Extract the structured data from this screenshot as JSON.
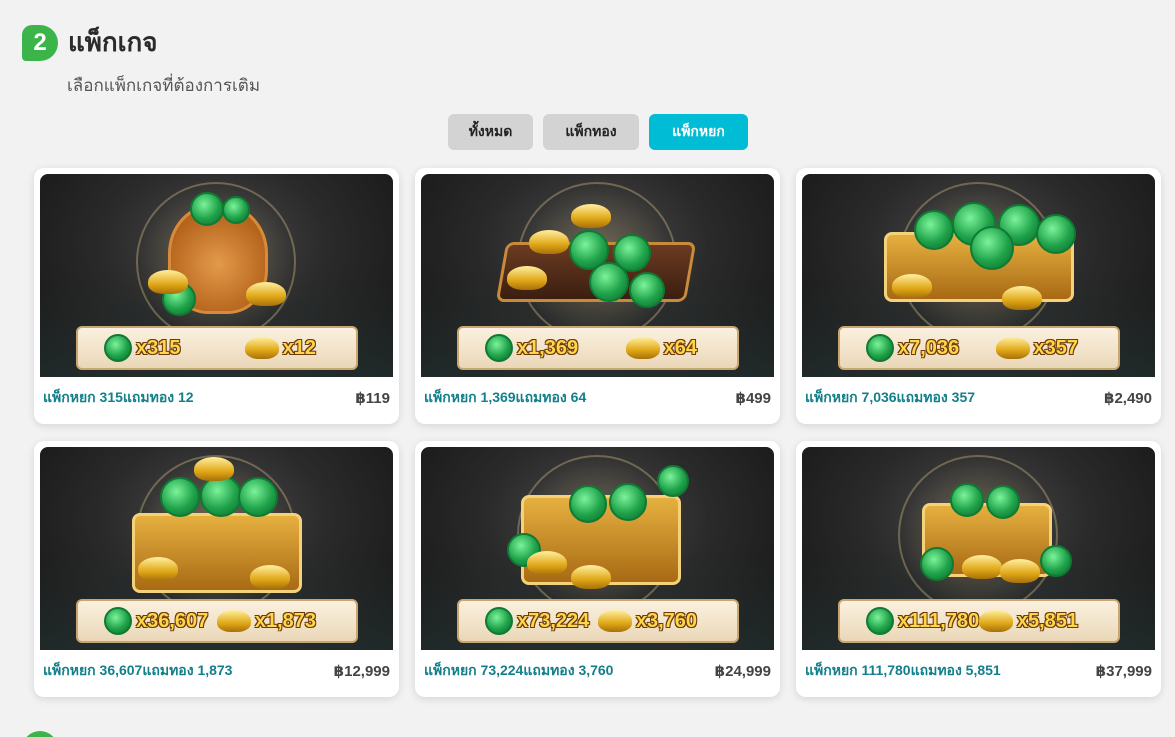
{
  "step": {
    "number": "2",
    "title": "แพ็กเกจ",
    "subtitle": "เลือกแพ็กเกจที่ต้องการเติม"
  },
  "tabs": [
    {
      "label": "ทั้งหมด",
      "active": false
    },
    {
      "label": "แพ็กทอง",
      "active": false
    },
    {
      "label": "แพ็กหยก",
      "active": true
    }
  ],
  "packages": [
    {
      "jade_qty": "x315",
      "gold_qty": "x12",
      "name": "แพ็กหยก 315แถมทอง 12",
      "price": "฿119",
      "art": "bag"
    },
    {
      "jade_qty": "x1,369",
      "gold_qty": "x64",
      "name": "แพ็กหยก 1,369แถมทอง 64",
      "price": "฿499",
      "art": "tray"
    },
    {
      "jade_qty": "x7,036",
      "gold_qty": "x357",
      "name": "แพ็กหยก 7,036แถมทอง 357",
      "price": "฿2,490",
      "art": "crate"
    },
    {
      "jade_qty": "x36,607",
      "gold_qty": "x1,873",
      "name": "แพ็กหยก 36,607แถมทอง 1,873",
      "price": "฿12,999",
      "art": "chest"
    },
    {
      "jade_qty": "x73,224",
      "gold_qty": "x3,760",
      "name": "แพ็กหยก 73,224แถมทอง 3,760",
      "price": "฿24,999",
      "art": "open-chest"
    },
    {
      "jade_qty": "x111,780",
      "gold_qty": "x5,851",
      "name": "แพ็กหยก 111,780แถมทอง 5,851",
      "price": "฿37,999",
      "art": "ornate-chest"
    }
  ],
  "colors": {
    "accent": "#00bcd4",
    "step_green": "#3bb54a",
    "name_teal": "#127f8a"
  }
}
